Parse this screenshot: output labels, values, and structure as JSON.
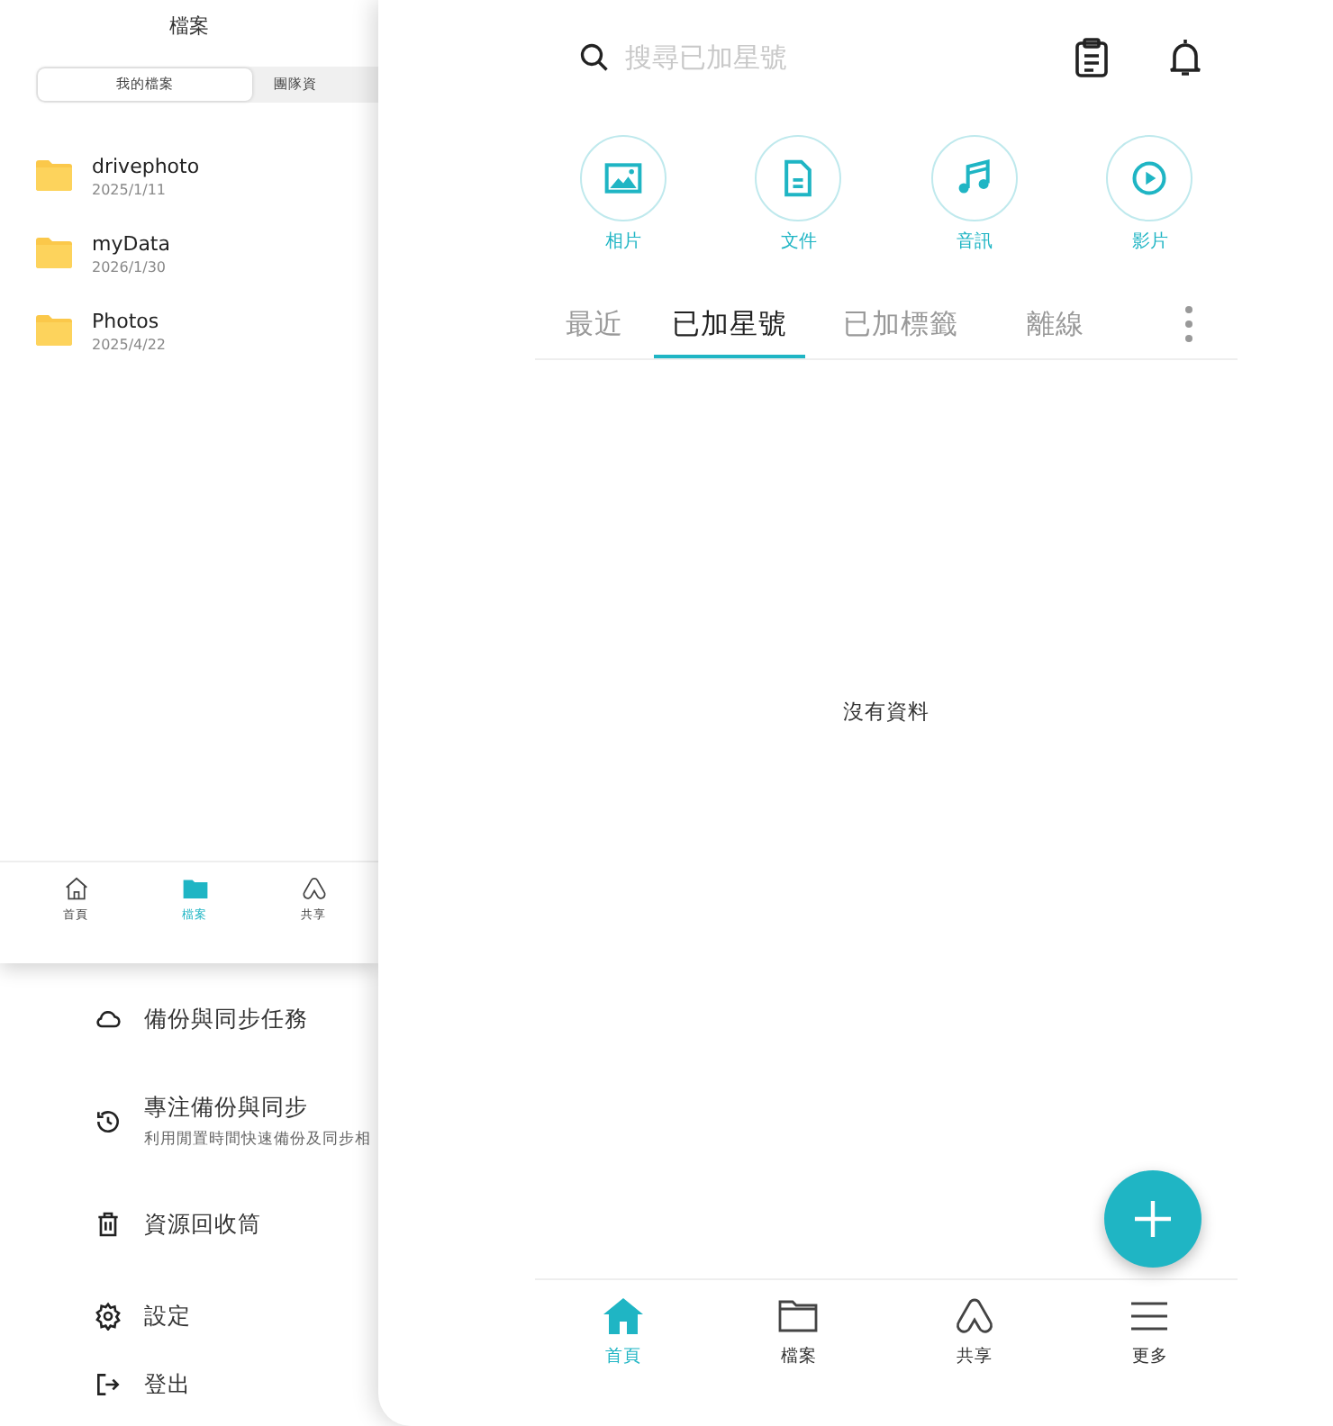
{
  "files_window": {
    "title": "檔案",
    "segments": [
      {
        "label": "我的檔案",
        "selected": true
      },
      {
        "label": "團隊資",
        "selected": false
      }
    ],
    "folders": [
      {
        "name": "drivephoto",
        "date": "2025/1/11"
      },
      {
        "name": "myData",
        "date": "2026/1/30"
      },
      {
        "name": "Photos",
        "date": "2025/4/22"
      }
    ],
    "nav": [
      {
        "label": "首頁",
        "selected": false
      },
      {
        "label": "檔案",
        "selected": true
      },
      {
        "label": "共享",
        "selected": false
      }
    ]
  },
  "side_menu": {
    "items": [
      {
        "label": "備份與同步任務"
      },
      {
        "label": "專注備份與同步",
        "subtitle": "利用閒置時間快速備份及同步相"
      },
      {
        "label": "資源回收筒"
      },
      {
        "label": "設定"
      },
      {
        "label": "登出"
      }
    ]
  },
  "main": {
    "search": {
      "placeholder": "搜尋已加星號"
    },
    "categories": [
      {
        "label": "相片"
      },
      {
        "label": "文件"
      },
      {
        "label": "音訊"
      },
      {
        "label": "影片"
      }
    ],
    "tabs": [
      {
        "label": "最近",
        "selected": false
      },
      {
        "label": "已加星號",
        "selected": true
      },
      {
        "label": "已加標籤",
        "selected": false
      },
      {
        "label": "離線",
        "selected": false
      }
    ],
    "empty_message": "沒有資料",
    "nav": [
      {
        "label": "首頁",
        "selected": true
      },
      {
        "label": "檔案",
        "selected": false
      },
      {
        "label": "共享",
        "selected": false
      },
      {
        "label": "更多",
        "selected": false
      }
    ]
  }
}
